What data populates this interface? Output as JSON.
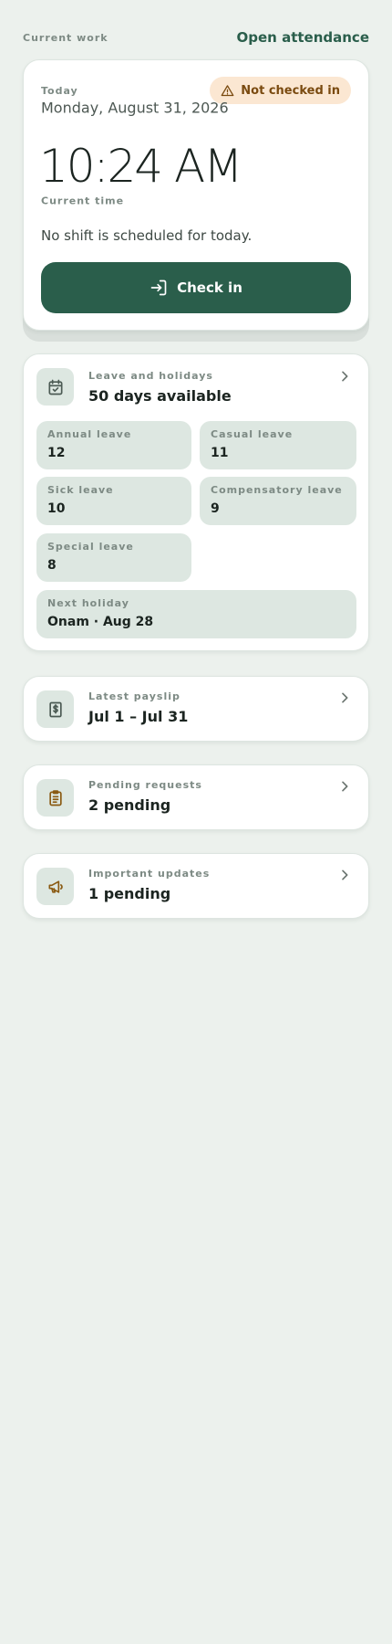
{
  "header": {
    "section_label": "Current work",
    "open_attendance": "Open attendance"
  },
  "attendance": {
    "today_label": "Today",
    "status_badge": "Not checked in",
    "date": "Monday, August 31, 2026",
    "time": "10:24 AM",
    "time_label": "Current time",
    "shift_message": "No shift is scheduled for today.",
    "check_in_label": "Check in"
  },
  "leave": {
    "title": "Leave and holidays",
    "summary": "50 days available",
    "balances": [
      {
        "label": "Annual leave",
        "value": "12"
      },
      {
        "label": "Casual leave",
        "value": "11"
      },
      {
        "label": "Sick leave",
        "value": "10"
      },
      {
        "label": "Compensatory leave",
        "value": "9"
      },
      {
        "label": "Special leave",
        "value": "8"
      }
    ],
    "next_holiday_label": "Next holiday",
    "next_holiday_value": "Onam · Aug 28"
  },
  "payslip": {
    "title": "Latest payslip",
    "value": "Jul 1 – Jul 31"
  },
  "requests": {
    "title": "Pending requests",
    "value": "2 pending"
  },
  "updates": {
    "title": "Important updates",
    "value": "1 pending"
  },
  "colors": {
    "background": "#ecf1ed",
    "primary": "#2a5e4b",
    "badge_bg": "#fbe7d2",
    "badge_text": "#7a4a0f",
    "tile_bg": "#dde7e1",
    "icon_accent": "#8a5a12"
  },
  "icons": {
    "badge": "warning-triangle-icon",
    "check_in": "login-arrow-icon",
    "leave": "calendar-check-icon",
    "payslip": "dollar-receipt-icon",
    "requests": "clipboard-list-icon",
    "updates": "megaphone-icon",
    "chevron": "chevron-right-icon"
  }
}
